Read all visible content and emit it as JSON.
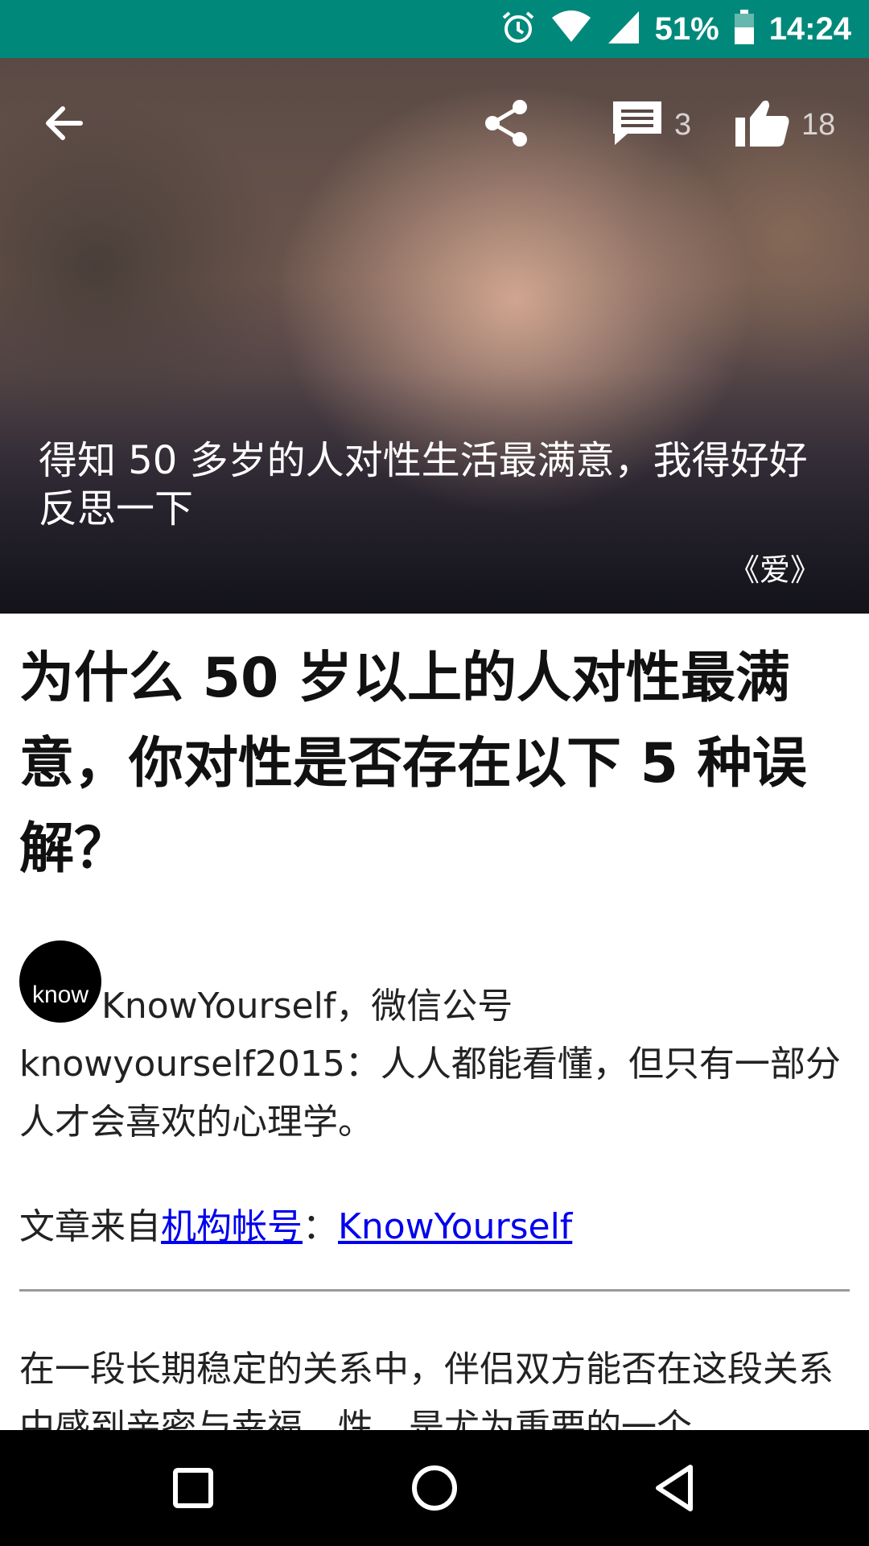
{
  "status_bar": {
    "battery": "51%",
    "time": "14:24",
    "icons": [
      "alarm-icon",
      "wifi-icon",
      "signal-icon",
      "battery-icon"
    ]
  },
  "toolbar": {
    "comment_count": "3",
    "like_count": "18",
    "icons": [
      "back-arrow-icon",
      "share-icon",
      "comment-icon",
      "thumbs-up-icon"
    ]
  },
  "hero": {
    "caption": "得知 50 多岁的人对性生活最满意，我得好好反思一下",
    "credit": "《爱》"
  },
  "article": {
    "title": "为什么 50 岁以上的人对性最满意，你对性是否存在以下 5 种误解？",
    "avatar_text": "know",
    "author_line": "KnowYourself，微信公号 knowyourself2015：人人都能看懂，但只有一部分人才会喜欢的心理学。",
    "source_prefix": "文章来自",
    "source_link": "机构帐号",
    "source_sep": "：",
    "source_author": "KnowYourself",
    "body": "在一段长期稳定的关系中，伴侣双方能否在这段关系中感到亲密与幸福，性，是尤为重要的一个"
  },
  "nav": {
    "icons": [
      "recents-square-icon",
      "home-circle-icon",
      "back-triangle-icon"
    ]
  },
  "colors": {
    "status_bar": "#00897b",
    "link": "#0000ee"
  }
}
